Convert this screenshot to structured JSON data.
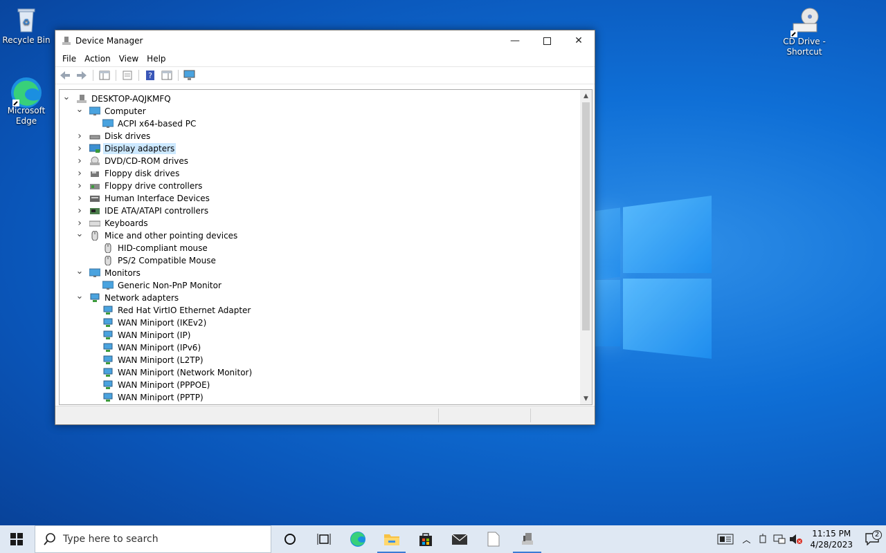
{
  "desktop": {
    "icons": [
      {
        "label": "Recycle Bin"
      },
      {
        "label": "Microsoft Edge"
      },
      {
        "label": "CD Drive - Shortcut"
      }
    ]
  },
  "window": {
    "title": "Device Manager",
    "menu": [
      "File",
      "Action",
      "View",
      "Help"
    ],
    "tree": {
      "root": "DESKTOP-AQJKMFQ",
      "items": [
        {
          "label": "Computer"
        },
        {
          "label": "ACPI x64-based PC"
        },
        {
          "label": "Disk drives"
        },
        {
          "label": "Display adapters"
        },
        {
          "label": "DVD/CD-ROM drives"
        },
        {
          "label": "Floppy disk drives"
        },
        {
          "label": "Floppy drive controllers"
        },
        {
          "label": "Human Interface Devices"
        },
        {
          "label": "IDE ATA/ATAPI controllers"
        },
        {
          "label": "Keyboards"
        },
        {
          "label": "Mice and other pointing devices"
        },
        {
          "label": "HID-compliant mouse"
        },
        {
          "label": "PS/2 Compatible Mouse"
        },
        {
          "label": "Monitors"
        },
        {
          "label": "Generic Non-PnP Monitor"
        },
        {
          "label": "Network adapters"
        },
        {
          "label": "Red Hat VirtIO Ethernet Adapter"
        },
        {
          "label": "WAN Miniport (IKEv2)"
        },
        {
          "label": "WAN Miniport (IP)"
        },
        {
          "label": "WAN Miniport (IPv6)"
        },
        {
          "label": "WAN Miniport (L2TP)"
        },
        {
          "label": "WAN Miniport (Network Monitor)"
        },
        {
          "label": "WAN Miniport (PPPOE)"
        },
        {
          "label": "WAN Miniport (PPTP)"
        }
      ]
    }
  },
  "taskbar": {
    "search_placeholder": "Type here to search",
    "time": "11:15 PM",
    "date": "4/28/2023",
    "notification_count": "2"
  },
  "colors": {
    "accent": "#0078d7",
    "selection": "#cce8ff"
  }
}
